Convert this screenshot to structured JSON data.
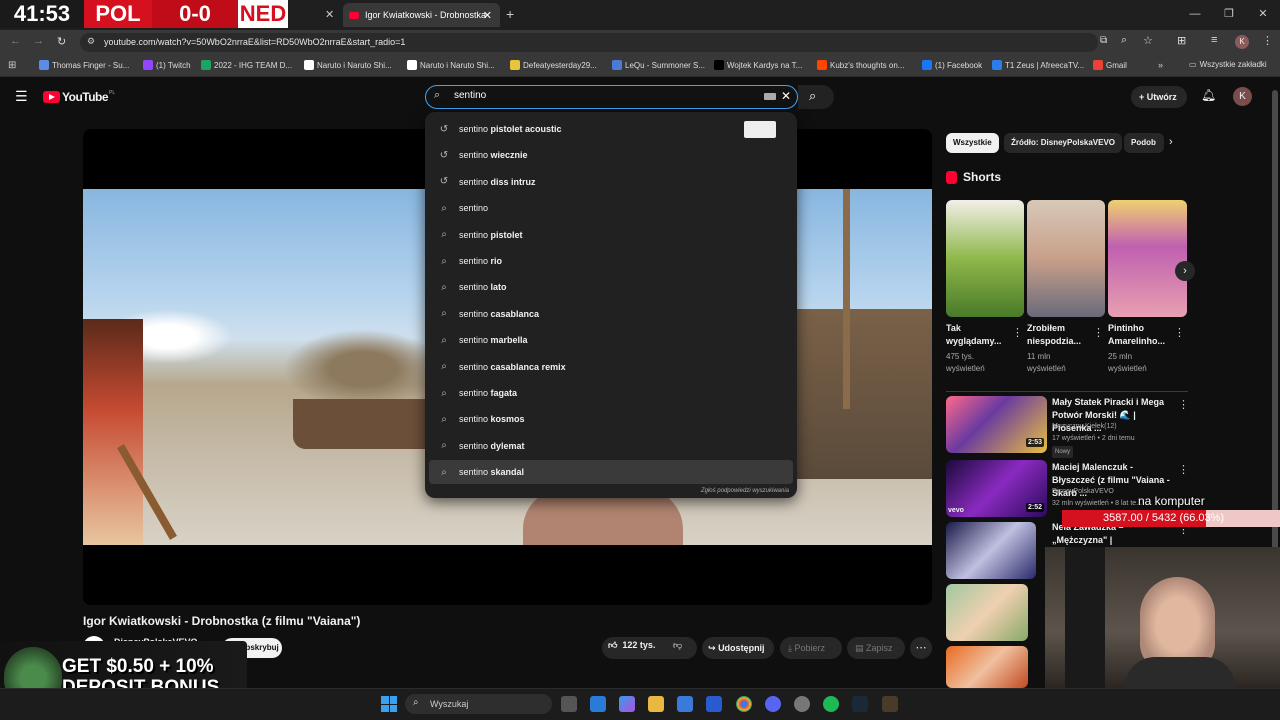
{
  "stream_overlay": {
    "scoreboard": {
      "time": "41:53",
      "team1": "POL",
      "score": "0-0",
      "team2": "NED"
    },
    "label": "na komputer",
    "progress_text": "3587.00 / 5432 (66.03%)",
    "progress": 0.6603,
    "ad_text_line1": "GET $0.50 + 10%",
    "ad_text_line2": "DEPOSIT BONUS"
  },
  "browser": {
    "active_tab": "Igor Kwiatkowski - Drobnostka",
    "url": "youtube.com/watch?v=50WbO2nrraE&list=RD50WbO2nrraE&start_radio=1",
    "bookmarks": [
      {
        "label": "Thomas Finger - Su...",
        "color": "#5b8de8"
      },
      {
        "label": "(1) Twitch",
        "color": "#9146ff"
      },
      {
        "label": "2022 - IHG TEAM D...",
        "color": "#1ea362"
      },
      {
        "label": "Naruto i Naruto Shi...",
        "color": "#ffffff"
      },
      {
        "label": "Naruto i Naruto Shi...",
        "color": "#ffffff"
      },
      {
        "label": "Defeatyesterday29...",
        "color": "#e8c53a"
      },
      {
        "label": "LeQu - Summoner S...",
        "color": "#4a7bd8"
      },
      {
        "label": "Wojtek Kardys na T...",
        "color": "#000000"
      },
      {
        "label": "Kubz's thoughts on...",
        "color": "#ff4500"
      },
      {
        "label": "(1) Facebook",
        "color": "#1877f2"
      },
      {
        "label": "T1 Zeus | AfreecaTV...",
        "color": "#2b7de9"
      },
      {
        "label": "Gmail",
        "color": "#ea4335"
      }
    ],
    "all_bookmarks": "Wszystkie zakładki"
  },
  "youtube": {
    "logo": "YouTube",
    "region": "PL",
    "search_value": "sentino",
    "create_label": "Utwórz",
    "avatar_letter": "K",
    "suggestions": [
      {
        "prefix": "sentino",
        "suffix": " pistolet acoustic",
        "icon": "history-icon"
      },
      {
        "prefix": "sentino",
        "suffix": " wiecznie",
        "icon": "history-icon"
      },
      {
        "prefix": "sentino",
        "suffix": " diss intruz",
        "icon": "history-icon"
      },
      {
        "prefix": "sentino",
        "suffix": "",
        "icon": "search-icon"
      },
      {
        "prefix": "sentino",
        "suffix": " pistolet",
        "icon": "search-icon"
      },
      {
        "prefix": "sentino",
        "suffix": " rio",
        "icon": "search-icon"
      },
      {
        "prefix": "sentino",
        "suffix": " lato",
        "icon": "search-icon"
      },
      {
        "prefix": "sentino",
        "suffix": " casablanca",
        "icon": "search-icon"
      },
      {
        "prefix": "sentino",
        "suffix": " marbella",
        "icon": "search-icon"
      },
      {
        "prefix": "sentino",
        "suffix": " casablanca remix",
        "icon": "search-icon"
      },
      {
        "prefix": "sentino",
        "suffix": " fagata",
        "icon": "search-icon"
      },
      {
        "prefix": "sentino",
        "suffix": " kosmos",
        "icon": "search-icon"
      },
      {
        "prefix": "sentino",
        "suffix": " dylemat",
        "icon": "search-icon"
      },
      {
        "prefix": "sentino",
        "suffix": " skandal",
        "icon": "search-icon"
      }
    ],
    "report_link": "Zgłoś podpowiedzi wyszukiwania",
    "video": {
      "title": "Igor Kwiatkowski - Drobnostka (z filmu \"Vaiana\")",
      "channel": "DisneyPolskaVEVO",
      "subscribe": "Subskrybuj",
      "likes": "122 tys.",
      "share": "Udostępnij",
      "download": "Pobierz",
      "save": "Zapisz"
    },
    "chips": [
      "Wszystkie",
      "Źródło: DisneyPolskaVEVO",
      "Podob"
    ],
    "shorts_heading": "Shorts",
    "shorts": [
      {
        "title": "Tak wyglądamy...",
        "views": "475 tys. wyświetleń"
      },
      {
        "title": "Zrobiłem niespodzia...",
        "views": "11 mln wyświetleń"
      },
      {
        "title": "Pintinho Amarelinho...",
        "views": "25 mln wyświetleń"
      }
    ],
    "related": [
      {
        "title": "Mały Statek Piracki i Mega Potwór Morski! 🌊 | Piosenka ...",
        "channel": "Muzyczny Kiełek(12)",
        "stats": "17 wyświetleń • 2 dni temu",
        "badge": "Nowy",
        "duration": "2:53"
      },
      {
        "title": "Maciej Malenczuk - Błyszczeć (z filmu \"Vaiana - Skarb ...",
        "channel": "DisneyPolskaVEVO",
        "stats": "32 mln wyświetleń • 8 lat te...",
        "badge": "",
        "duration": "2:52"
      },
      {
        "title": "Nela Zawadzka – „Mężczyzna\" | Przesłuchania w ciemno – The...",
        "channel": "",
        "stats": "",
        "badge": "",
        "duration": ""
      }
    ]
  },
  "taskbar": {
    "search_label": "Wyszukaj"
  }
}
